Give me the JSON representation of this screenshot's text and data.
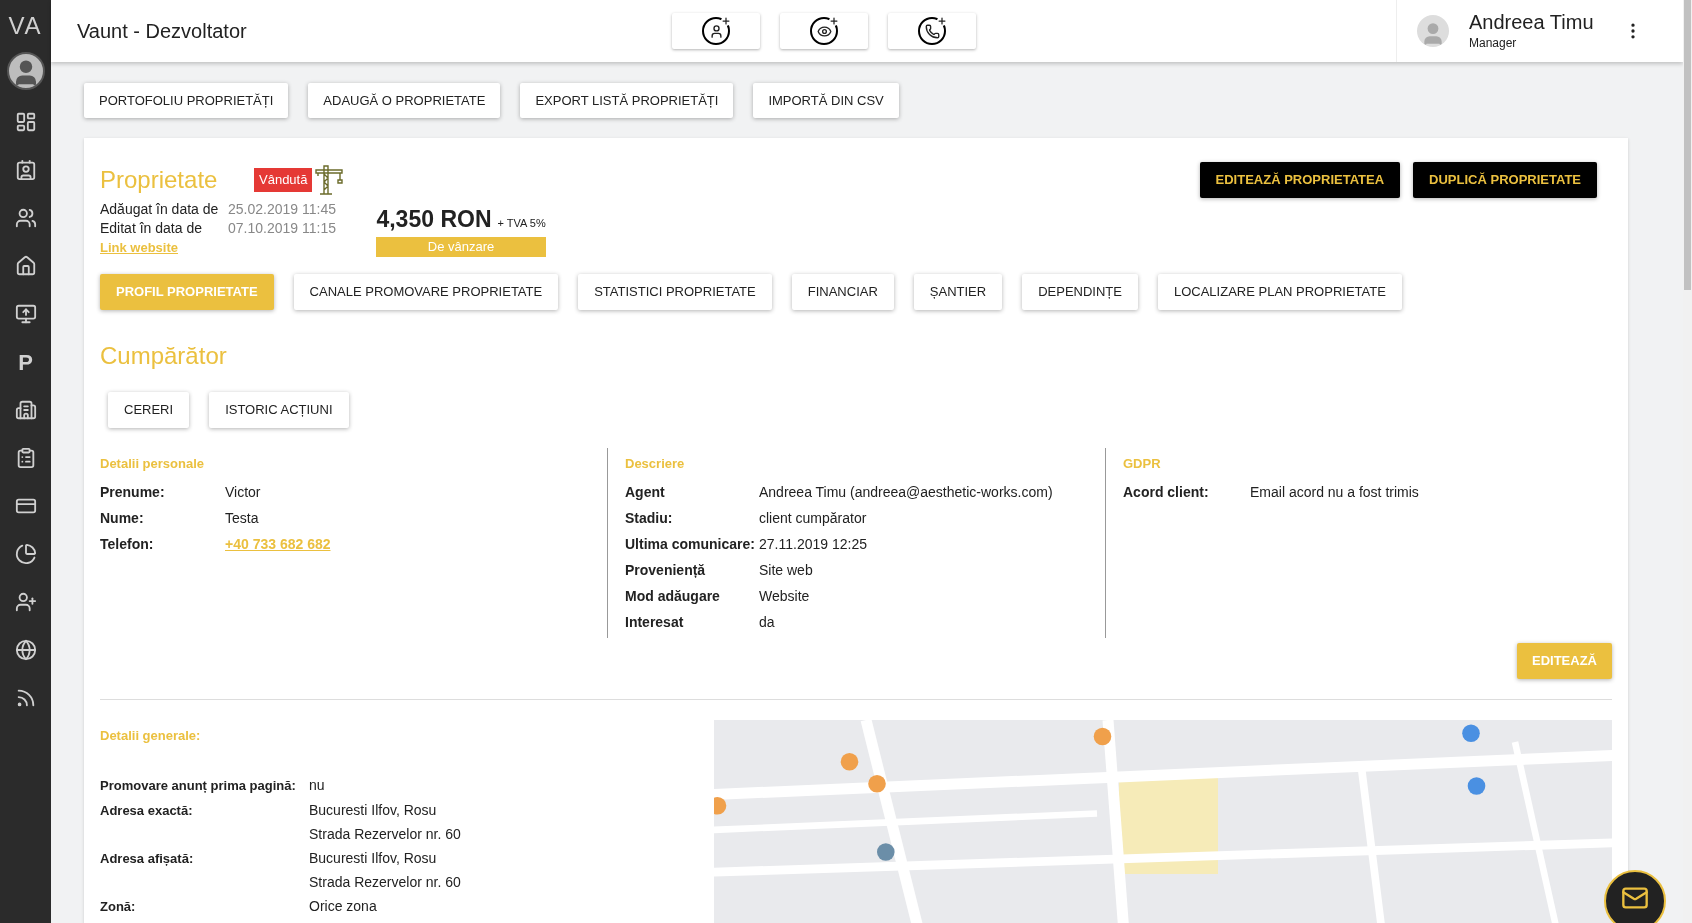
{
  "sidebar": {
    "logo": "VA",
    "letter_item": "P"
  },
  "header": {
    "title": "Vaunt - Dezvoltator",
    "user": {
      "name": "Andreea Timu",
      "role": "Manager"
    }
  },
  "actions": [
    "PORTOFOLIU PROPRIETĂȚI",
    "ADAUGĂ O PROPRIETATE",
    "EXPORT LISTĂ PROPRIETĂȚI",
    "IMPORTĂ DIN CSV"
  ],
  "property": {
    "title": "Proprietate",
    "badge": "Vândută",
    "added_label": "Adăugat în data de",
    "added_value": "25.02.2019 11:45",
    "edited_label": "Editat în data de",
    "edited_value": "07.10.2019 11:15",
    "link": "Link website",
    "price": "4,350 RON",
    "vat": "+ TVA 5%",
    "status": "De vânzare",
    "buttons": [
      "EDITEAZĂ PROPRIETATEA",
      "DUPLICĂ PROPRIETATE"
    ]
  },
  "tabs": [
    {
      "label": "PROFIL PROPRIETATE",
      "selected": true
    },
    {
      "label": "CANALE PROMOVARE PROPRIETATE",
      "selected": false
    },
    {
      "label": "STATISTICI PROPRIETATE",
      "selected": false
    },
    {
      "label": "FINANCIAR",
      "selected": false
    },
    {
      "label": "ȘANTIER",
      "selected": false
    },
    {
      "label": "DEPENDINȚE",
      "selected": false
    },
    {
      "label": "LOCALIZARE PLAN PROPRIETATE",
      "selected": false
    }
  ],
  "buyer": {
    "title": "Cumpărător",
    "subtabs": [
      {
        "label": "CERERI",
        "selected": false
      },
      {
        "label": "ISTORIC ACȚIUNI",
        "selected": false
      }
    ],
    "columns": [
      {
        "heading": "Detalii personale",
        "rows": [
          {
            "label": "Prenume:",
            "value": "Victor",
            "kind": "text"
          },
          {
            "label": "Nume:",
            "value": "Testa",
            "kind": "text"
          },
          {
            "label": "Telefon:",
            "value": "+40 733 682 682",
            "kind": "link"
          }
        ]
      },
      {
        "heading": "Descriere",
        "rows": [
          {
            "label": "Agent",
            "value": "Andreea Timu (andreea@aesthetic-works.com)",
            "kind": "text"
          },
          {
            "label": "Stadiu:",
            "value": "client cumpărator",
            "kind": "text"
          },
          {
            "label": "Ultima comunicare:",
            "value": "27.11.2019 12:25",
            "kind": "text"
          },
          {
            "label": "Proveniență",
            "value": "Site web",
            "kind": "text"
          },
          {
            "label": "Mod adăugare",
            "value": "Website",
            "kind": "text"
          },
          {
            "label": "Interesat",
            "value": "da",
            "kind": "text"
          }
        ]
      },
      {
        "heading": "GDPR",
        "rows": [
          {
            "label": "Acord client:",
            "value": "Email acord nu a fost trimis",
            "kind": "text"
          }
        ]
      }
    ],
    "edit_button": "EDITEAZĂ"
  },
  "general": {
    "heading": "Detalii generale:",
    "rows": [
      {
        "label": "Promovare anunț prima pagină:",
        "lines": [
          "nu"
        ]
      },
      {
        "label": "Adresa exactă:",
        "lines": [
          "Bucuresti Ilfov, Rosu",
          "Strada Rezervelor nr. 60"
        ]
      },
      {
        "label": "Adresa afișată:",
        "lines": [
          "Bucuresti Ilfov, Rosu",
          "Strada Rezervelor nr. 60"
        ]
      },
      {
        "label": "Zonă:",
        "lines": [
          "Orice zona"
        ]
      }
    ]
  }
}
